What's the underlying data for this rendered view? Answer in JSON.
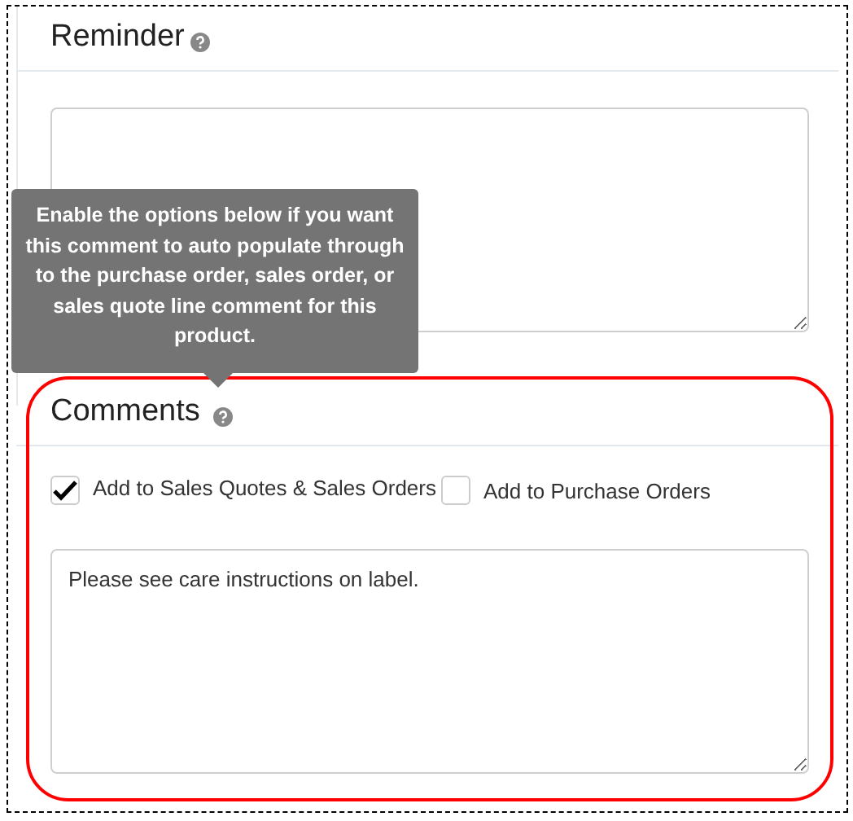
{
  "reminder": {
    "title": "Reminder"
  },
  "tooltip": {
    "text": "Enable the options below if you want this comment to auto populate through to the purchase order, sales order, or sales quote line comment for this product."
  },
  "comments": {
    "title": "Comments",
    "options": [
      {
        "label": "Add to Sales Quotes & Sales Orders",
        "checked": true
      },
      {
        "label": "Add to Purchase Orders",
        "checked": false
      }
    ],
    "value": "Please see care instructions on label."
  }
}
